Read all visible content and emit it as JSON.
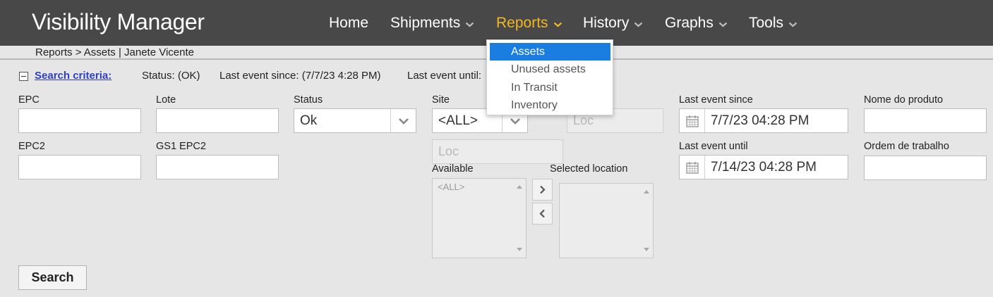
{
  "app": {
    "title": "Visibility Manager"
  },
  "nav": {
    "home": "Home",
    "shipments": "Shipments",
    "reports": "Reports",
    "history": "History",
    "graphs": "Graphs",
    "tools": "Tools"
  },
  "breadcrumb": "Reports > Assets | Janete Vicente",
  "criteria": {
    "link": "Search criteria:",
    "status_summary": "Status: (OK)",
    "since_summary": "Last event since: (7/7/23 4:28 PM)",
    "until_summary": "Last event until:"
  },
  "fields": {
    "epc": {
      "label": "EPC",
      "value": ""
    },
    "lote": {
      "label": "Lote",
      "value": ""
    },
    "status": {
      "label": "Status",
      "value": "Ok"
    },
    "site": {
      "label": "Site",
      "value": "<ALL>"
    },
    "loc_top": {
      "placeholder": "Loc"
    },
    "loc": {
      "placeholder": "Loc"
    },
    "last_event_since": {
      "label": "Last event since",
      "value": "7/7/23 04:28 PM"
    },
    "nome_do_produto": {
      "label": "Nome do produto",
      "value": ""
    },
    "epc2": {
      "label": "EPC2",
      "value": ""
    },
    "gs1_epc2": {
      "label": "GS1 EPC2",
      "value": ""
    },
    "last_event_until": {
      "label": "Last event until",
      "value": "7/14/23 04:28 PM"
    },
    "ordem_de_trabalho": {
      "label": "Ordem de trabalho",
      "value": ""
    }
  },
  "locations": {
    "available_label": "Available",
    "available_options": [
      "<ALL>"
    ],
    "selected_label": "Selected location",
    "selected_options": []
  },
  "search_button": "Search",
  "reports_menu": {
    "items": [
      "Assets",
      "Unused assets",
      "In Transit",
      "Inventory"
    ],
    "selected": "Assets"
  },
  "colors": {
    "topbar": "#484848",
    "active_nav": "#f0b723",
    "menu_highlight": "#1a7ee0",
    "link": "#2f3fbf",
    "background": "#e6e6e6"
  }
}
